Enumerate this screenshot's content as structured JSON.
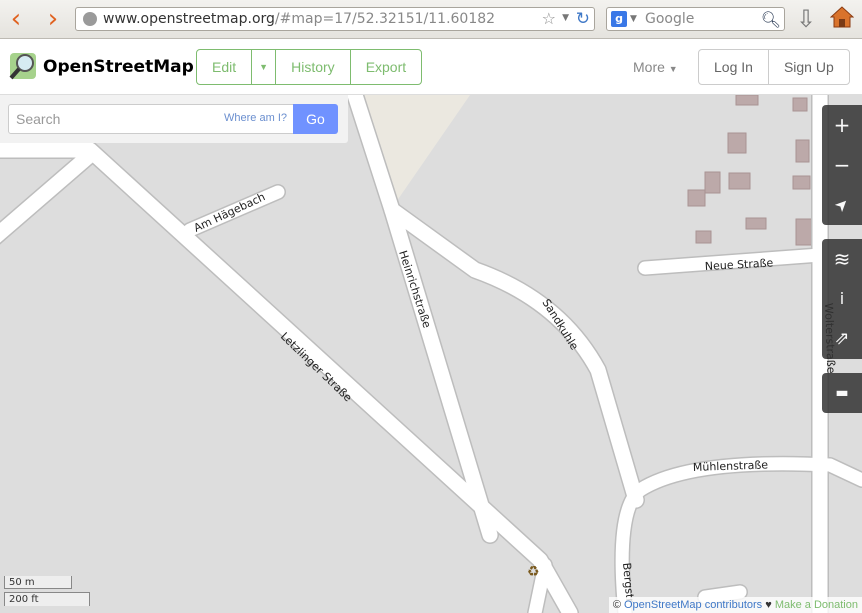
{
  "browser": {
    "url_host": "www.openstreetmap.org",
    "url_path": "/#map=17/52.32151/11.60182",
    "search_engine_placeholder": "Google",
    "back_icon": "back-arrow-icon",
    "forward_icon": "forward-arrow-icon"
  },
  "header": {
    "logo_text": "OpenStreetMap",
    "edit_label": "Edit",
    "history_label": "History",
    "export_label": "Export",
    "more_label": "More",
    "login_label": "Log In",
    "signup_label": "Sign Up"
  },
  "search": {
    "placeholder": "Search",
    "where_am_i": "Where am I?",
    "go_label": "Go"
  },
  "map": {
    "streets": {
      "am_hagebach": "Am Hägebach",
      "heinrichstrasse": "Heinrichstraße",
      "sandkuhle": "Sandkuhle",
      "neue_strasse": "Neue Straße",
      "wolterstrasse": "Wolterstraße",
      "letzlinger_strasse": "Letzlinger Straße",
      "muhlenstrasse": "Mühlenstraße",
      "bergstrasse": "Bergstr"
    },
    "colors": {
      "land": "#dddddd",
      "road": "#ffffff",
      "building": "#bca9a9",
      "accent": "#7ebc6f"
    },
    "recycling_icon": "recycling-icon"
  },
  "controls": {
    "zoom_in": "+",
    "zoom_out": "−",
    "locate": "➤",
    "layers": "≋",
    "info": "ⅰ",
    "share": "⇗",
    "note": "▬"
  },
  "scale": {
    "metric": "50 m",
    "imperial": "200 ft"
  },
  "attribution": {
    "prefix": "© ",
    "link": "OpenStreetMap contributors",
    "heart": " ♥ ",
    "donation": "Make a Donation"
  }
}
